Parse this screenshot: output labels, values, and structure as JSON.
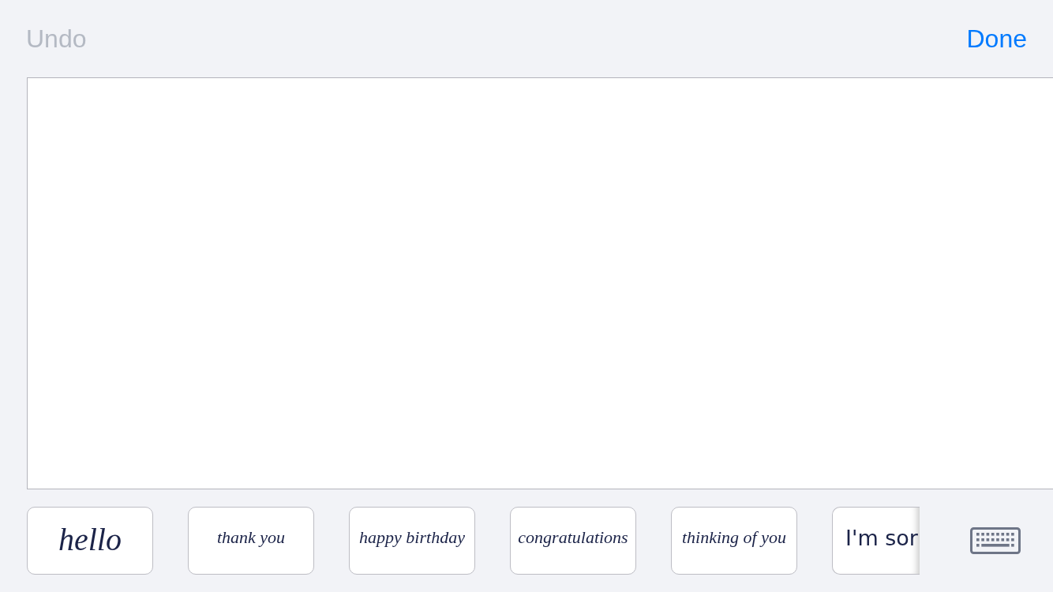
{
  "toolbar": [
    {
      "label": "Undo",
      "disabled": true
    },
    {
      "label": "Done",
      "disabled": false
    }
  ],
  "phrases": [
    "hello",
    "thank you",
    "happy birthday",
    "congratulations",
    "thinking of you",
    "I'm sor"
  ]
}
